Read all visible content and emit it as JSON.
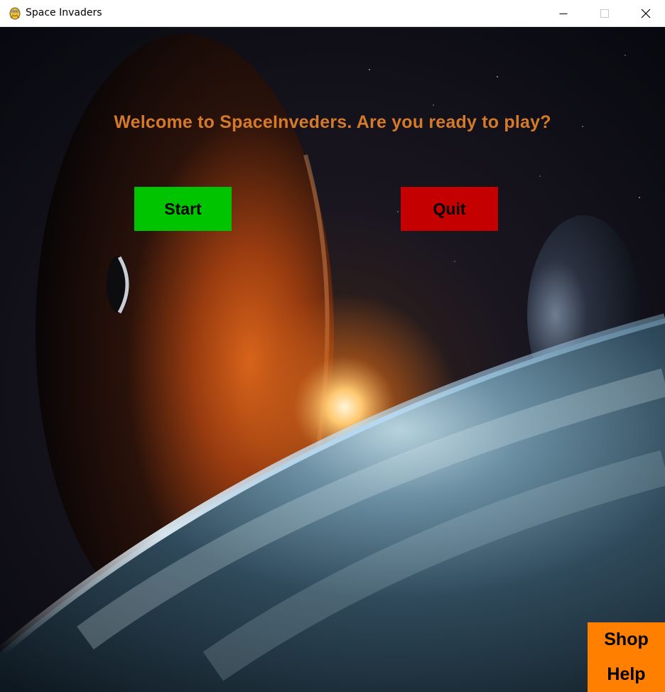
{
  "window": {
    "title": "Space Invaders",
    "icon": "pygame-snake-icon"
  },
  "window_controls": {
    "minimize_icon": "minimize-icon",
    "maximize_icon": "maximize-icon",
    "close_icon": "close-icon"
  },
  "menu": {
    "welcome_text": "Welcome to SpaceInveders. Are you ready to play?",
    "start_label": "Start",
    "quit_label": "Quit",
    "shop_label": "Shop",
    "help_label": "Help"
  },
  "colors": {
    "welcome": "#d47a2a",
    "start_button": "#00c400",
    "quit_button": "#c40000",
    "side_panel": "#ff7f00"
  }
}
